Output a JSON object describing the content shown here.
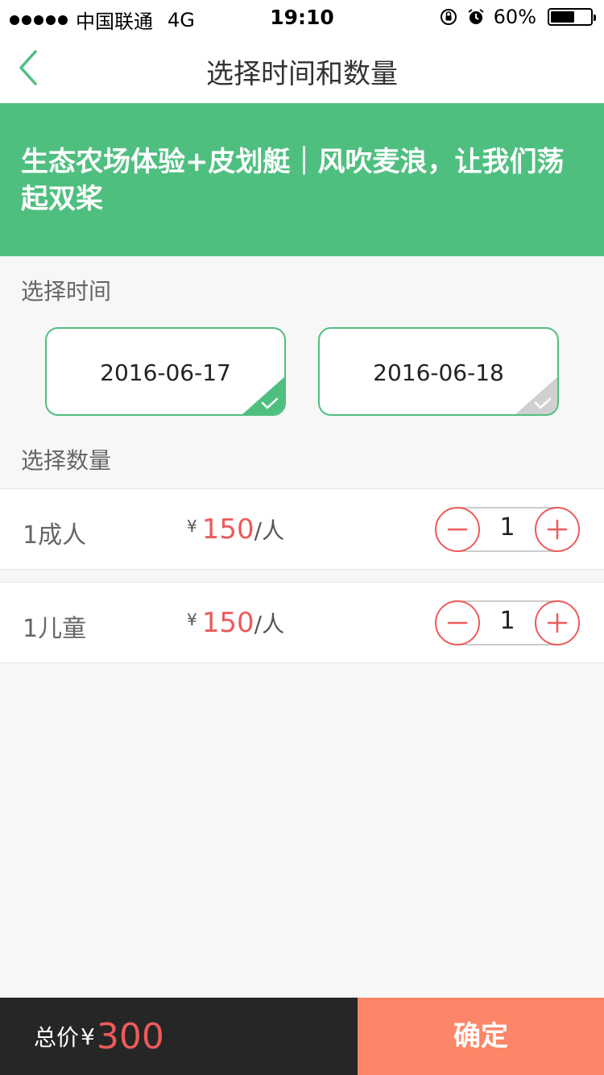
{
  "status_bar": {
    "carrier": "中国联通",
    "network": "4G",
    "time": "19:10",
    "battery_percent": "60%",
    "battery_level": 0.6
  },
  "nav": {
    "title": "选择时间和数量"
  },
  "banner": {
    "title": "生态农场体验+皮划艇｜风吹麦浪，让我们荡起双桨"
  },
  "select_time": {
    "label": "选择时间",
    "dates": [
      {
        "date": "2016-06-17",
        "selected": true
      },
      {
        "date": "2016-06-18",
        "selected": false
      }
    ]
  },
  "select_quantity": {
    "label": "选择数量",
    "rows": [
      {
        "label": "1成人",
        "currency": "¥",
        "price": "150",
        "unit": "/人",
        "quantity": "1"
      },
      {
        "label": "1儿童",
        "currency": "¥",
        "price": "150",
        "unit": "/人",
        "quantity": "1"
      }
    ]
  },
  "bottom": {
    "total_label": "总价",
    "currency": "¥",
    "total": "300",
    "confirm": "确定"
  },
  "colors": {
    "accent_green": "#4fbf80",
    "price_red": "#ee5a5a",
    "confirm_orange": "#fc8667",
    "bar_dark": "#262626"
  },
  "icons": [
    "back-icon",
    "orientation-lock-icon",
    "alarm-icon",
    "battery-icon",
    "check-icon",
    "minus-icon",
    "plus-icon"
  ]
}
